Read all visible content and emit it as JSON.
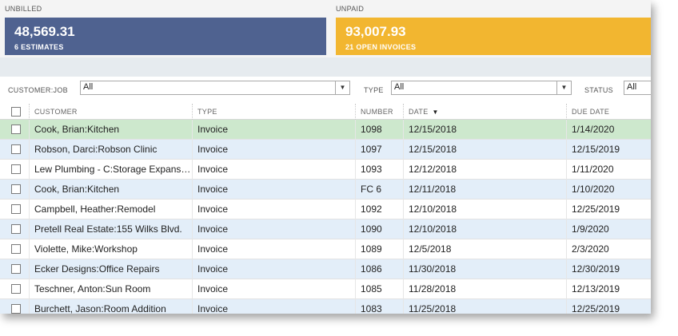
{
  "money_bar": {
    "unbilled_label": "UNBILLED",
    "unbilled_amount": "48,569.31",
    "unbilled_sub": "6 ESTIMATES",
    "unpaid_label": "UNPAID",
    "unpaid_amount": "93,007.93",
    "unpaid_sub": "21 OPEN INVOICES",
    "colors": {
      "unbilled": "#4f6290",
      "unpaid": "#f2b630"
    }
  },
  "filters": {
    "customer_job_label": "CUSTOMER:JOB",
    "customer_job_value": "All",
    "type_label": "TYPE",
    "type_value": "All",
    "status_label": "STATUS",
    "status_value": "All"
  },
  "table": {
    "columns": [
      "CUSTOMER",
      "TYPE",
      "NUMBER",
      "DATE",
      "DUE DATE"
    ],
    "sort_icon": "sort-descending-icon",
    "rows": [
      {
        "customer": "Cook, Brian:Kitchen",
        "type": "Invoice",
        "number": "1098",
        "date": "12/15/2018",
        "due": "1/14/2020"
      },
      {
        "customer": "Robson, Darci:Robson Clinic",
        "type": "Invoice",
        "number": "1097",
        "date": "12/15/2018",
        "due": "12/15/2019"
      },
      {
        "customer": "Lew Plumbing - C:Storage Expans…",
        "type": "Invoice",
        "number": "1093",
        "date": "12/12/2018",
        "due": "1/11/2020"
      },
      {
        "customer": "Cook, Brian:Kitchen",
        "type": "Invoice",
        "number": "FC 6",
        "date": "12/11/2018",
        "due": "1/10/2020"
      },
      {
        "customer": "Campbell, Heather:Remodel",
        "type": "Invoice",
        "number": "1092",
        "date": "12/10/2018",
        "due": "12/25/2019"
      },
      {
        "customer": "Pretell Real Estate:155 Wilks Blvd.",
        "type": "Invoice",
        "number": "1090",
        "date": "12/10/2018",
        "due": "1/9/2020"
      },
      {
        "customer": "Violette, Mike:Workshop",
        "type": "Invoice",
        "number": "1089",
        "date": "12/5/2018",
        "due": "2/3/2020"
      },
      {
        "customer": "Ecker Designs:Office Repairs",
        "type": "Invoice",
        "number": "1086",
        "date": "11/30/2018",
        "due": "12/30/2019"
      },
      {
        "customer": "Teschner, Anton:Sun Room",
        "type": "Invoice",
        "number": "1085",
        "date": "11/28/2018",
        "due": "12/13/2019"
      },
      {
        "customer": "Burchett, Jason:Room Addition",
        "type": "Invoice",
        "number": "1083",
        "date": "11/25/2018",
        "due": "12/25/2019"
      }
    ]
  }
}
